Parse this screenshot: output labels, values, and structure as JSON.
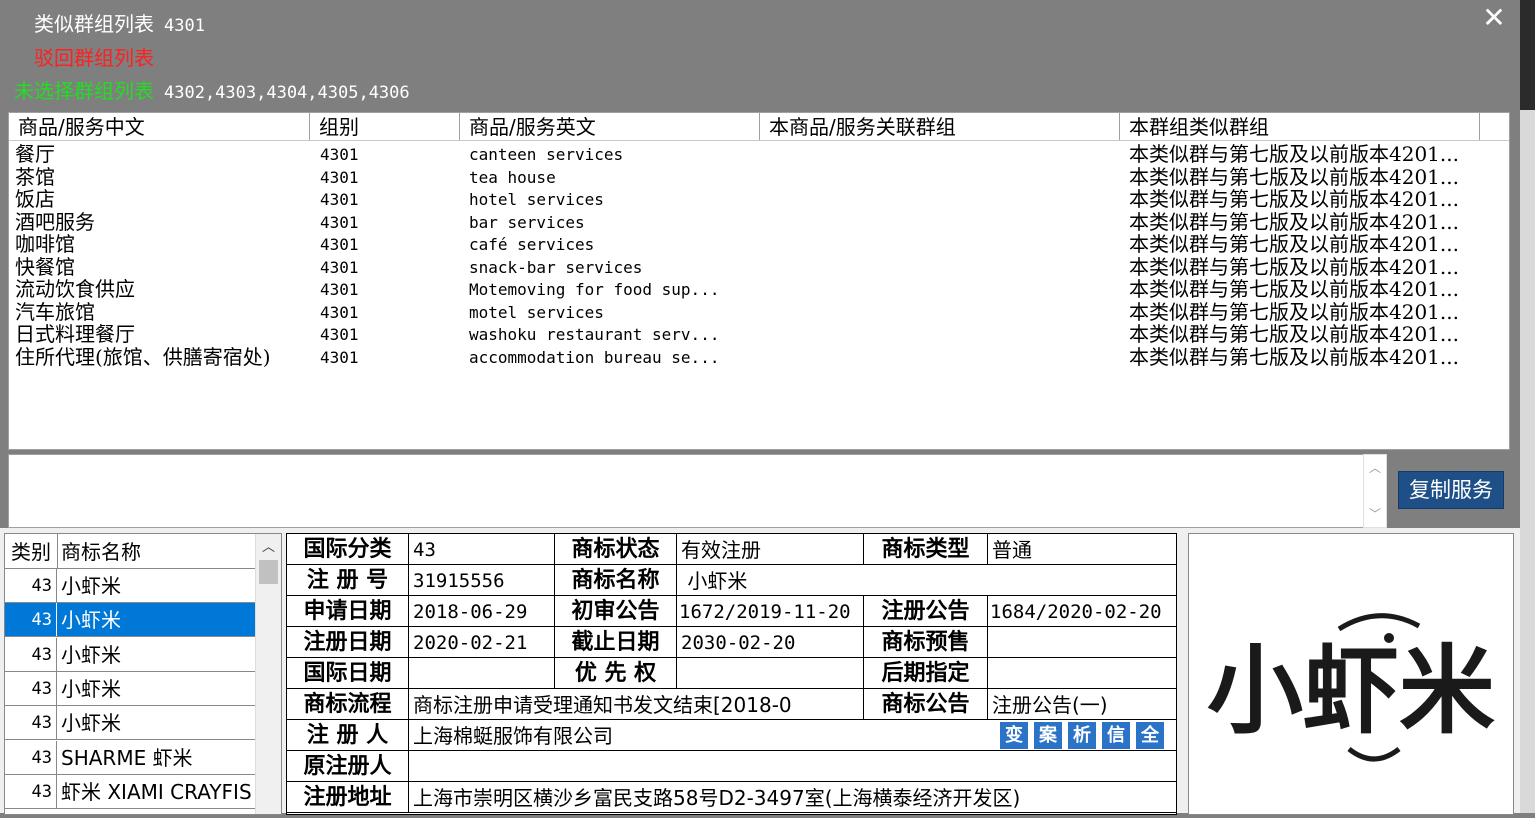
{
  "header": {
    "similar_label": "类似群组列表",
    "similar_value": "4301",
    "rejected_label": "驳回群组列表",
    "unselected_label": "未选择群组列表",
    "unselected_value": "4302,4303,4304,4305,4306",
    "close": "✕"
  },
  "services": {
    "columns": [
      "商品/服务中文",
      "组别",
      "商品/服务英文",
      "本商品/服务关联群组",
      "本群组类似群组"
    ],
    "rows": [
      {
        "cn": "餐厅",
        "group": "4301",
        "en": "canteen services",
        "similar": "本类似群与第七版及以前版本4201..."
      },
      {
        "cn": "茶馆",
        "group": "4301",
        "en": "tea house",
        "similar": "本类似群与第七版及以前版本4201..."
      },
      {
        "cn": "饭店",
        "group": "4301",
        "en": "hotel services",
        "similar": "本类似群与第七版及以前版本4201..."
      },
      {
        "cn": "酒吧服务",
        "group": "4301",
        "en": "bar services",
        "similar": "本类似群与第七版及以前版本4201..."
      },
      {
        "cn": "咖啡馆",
        "group": "4301",
        "en": "café services",
        "similar": "本类似群与第七版及以前版本4201..."
      },
      {
        "cn": "快餐馆",
        "group": "4301",
        "en": "snack-bar services",
        "similar": "本类似群与第七版及以前版本4201..."
      },
      {
        "cn": "流动饮食供应",
        "group": "4301",
        "en": "Motemoving for food sup...",
        "similar": "本类似群与第七版及以前版本4201..."
      },
      {
        "cn": "汽车旅馆",
        "group": "4301",
        "en": "motel services",
        "similar": "本类似群与第七版及以前版本4201..."
      },
      {
        "cn": "日式料理餐厅",
        "group": "4301",
        "en": "washoku restaurant serv...",
        "similar": "本类似群与第七版及以前版本4201..."
      },
      {
        "cn": "住所代理(旅馆、供膳寄宿处)",
        "group": "4301",
        "en": "accommodation bureau se...",
        "similar": "本类似群与第七版及以前版本4201..."
      }
    ]
  },
  "copy_button": "复制服务",
  "trademark_list": {
    "columns": [
      "类别",
      "商标名称"
    ],
    "rows": [
      {
        "cls": "43",
        "name": "小虾米"
      },
      {
        "cls": "43",
        "name": "小虾米"
      },
      {
        "cls": "43",
        "name": "小虾米"
      },
      {
        "cls": "43",
        "name": "小虾米"
      },
      {
        "cls": "43",
        "name": "小虾米"
      },
      {
        "cls": "43",
        "name": "SHARME 虾米"
      },
      {
        "cls": "43",
        "name": "虾米 XIAMI CRAYFISH"
      }
    ],
    "selected_index": 1
  },
  "detail": {
    "intl_class_label": "国际分类",
    "intl_class": "43",
    "status_label": "商标状态",
    "status": "有效注册",
    "type_label": "商标类型",
    "type": "普通",
    "reg_no_label": "注 册 号",
    "reg_no": "31915556",
    "name_label": "商标名称",
    "name": " 小虾米",
    "apply_date_label": "申请日期",
    "apply_date": "2018-06-29",
    "prelim_label": "初审公告",
    "prelim": "1672/2019-11-20",
    "reg_notice_label": "注册公告",
    "reg_notice": "1684/2020-02-20",
    "reg_date_label": "注册日期",
    "reg_date": "2020-02-21",
    "expiry_label": "截止日期",
    "expiry": "2030-02-20",
    "presale_label": "商标预售",
    "presale": "",
    "intl_date_label": "国际日期",
    "intl_date": "",
    "priority_label": "优 先 权",
    "priority": "",
    "later_label": "后期指定",
    "later": "",
    "flow_label": "商标流程",
    "flow": "商标注册申请受理通知书发文结束[2018-0",
    "gazette_label": "商标公告",
    "gazette": "注册公告(一)",
    "registrant_label": "注 册 人",
    "registrant": "上海棉蜓服饰有限公司",
    "orig_registrant_label": "原注册人",
    "orig_registrant": "",
    "address_label": "注册地址",
    "address": "上海市崇明区横沙乡富民支路58号D2-3497室(上海横泰经济开发区)",
    "mini_buttons": [
      "变",
      "案",
      "析",
      "信",
      "全"
    ]
  },
  "logo": {
    "text": "小虾米"
  },
  "colors": {
    "header_bg": "#7f7f7f",
    "header_text": "#ffffff",
    "rejected": "#ff2020",
    "unselected": "#22dd22",
    "accent": "#1e4f86",
    "selected_row": "#0078d7",
    "mini_button": "#2a73c6"
  }
}
